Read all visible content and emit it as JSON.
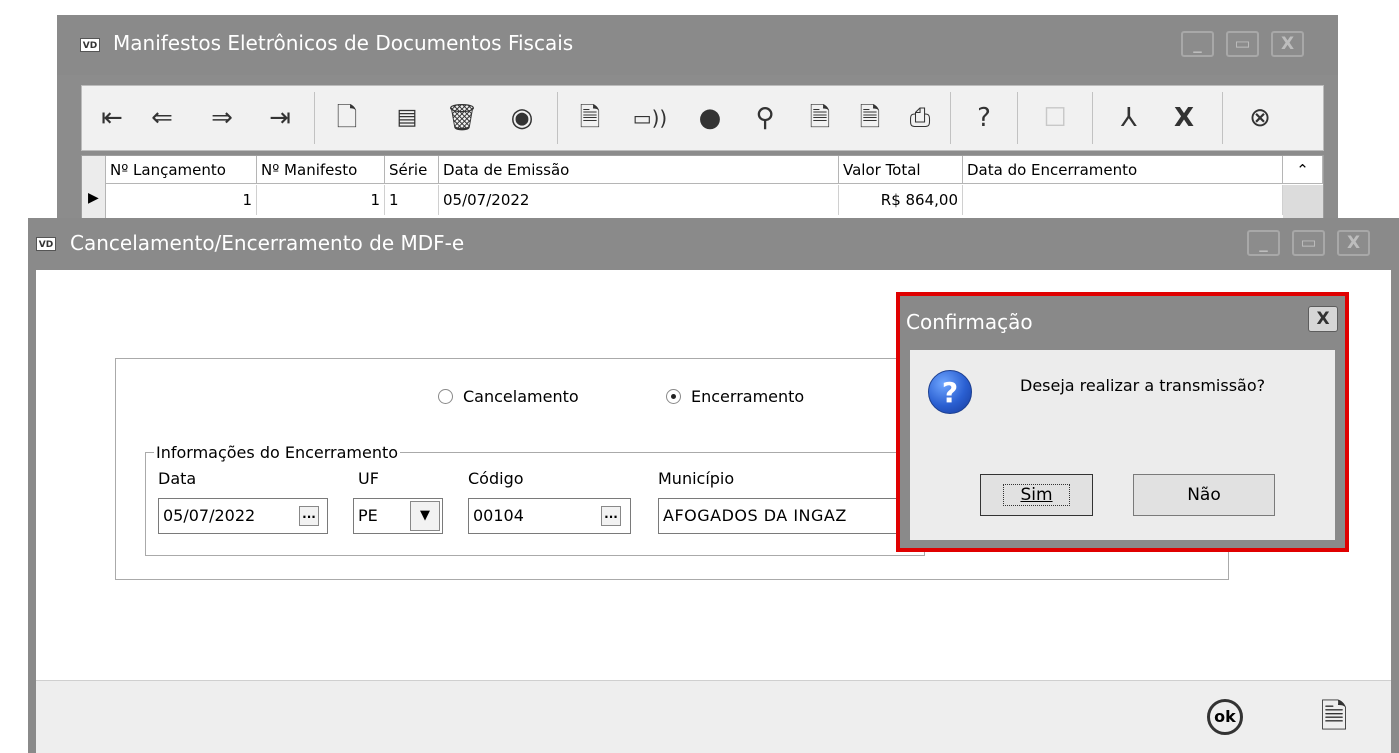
{
  "back_window": {
    "icon": "VD",
    "title": "Manifestos Eletrônicos de Documentos Fiscais",
    "window_buttons": [
      "_",
      "▭",
      "X"
    ],
    "toolbar_icons": [
      "first-record-icon",
      "prev-record-icon",
      "next-record-icon",
      "last-record-icon",
      "new-document-icon",
      "print-preview-icon",
      "trash-icon",
      "view-eye-icon",
      "send-document-icon",
      "transmit-signal-icon",
      "user-icon",
      "search-icon",
      "cancel-document-icon",
      "export-document-icon",
      "printer-icon",
      "help-icon",
      "edit-disabled-icon",
      "pdf-icon",
      "excel-icon",
      "close-circle-icon"
    ],
    "grid": {
      "headers": [
        "Nº Lançamento",
        "Nº Manifesto",
        "Série",
        "Data de Emissão",
        "Valor Total",
        "Data do Encerramento"
      ],
      "row": [
        "1",
        "1",
        "1",
        "05/07/2022",
        "R$ 864,00",
        ""
      ]
    }
  },
  "cancel_window": {
    "icon": "VD",
    "title": "Cancelamento/Encerramento de MDF-e",
    "options": {
      "cancel": "Cancelamento",
      "close": "Encerramento",
      "selected": "Encerramento"
    },
    "group_title": "Informações do Encerramento",
    "labels": {
      "data": "Data",
      "uf": "UF",
      "codigo": "Código",
      "municipio": "Município"
    },
    "values": {
      "data": "05/07/2022",
      "uf": "PE",
      "codigo": "00104",
      "municipio": "AFOGADOS DA INGAZ"
    },
    "footer_ok": "ok"
  },
  "dialog": {
    "title": "Confirmação",
    "message": "Deseja realizar a transmissão?",
    "yes": "Sim",
    "no": "Não",
    "accent": "#e00000"
  }
}
